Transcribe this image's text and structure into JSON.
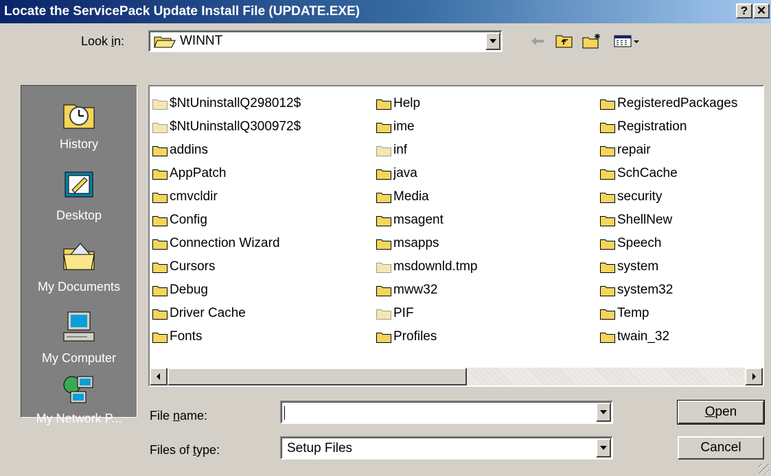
{
  "window": {
    "title": "Locate the ServicePack Update Install File (UPDATE.EXE)",
    "help_button": "?",
    "close_button": "✕"
  },
  "lookin": {
    "label_pre": "Look ",
    "label_u": "i",
    "label_post": "n:",
    "value": "WINNT"
  },
  "toolbar": {
    "icons": [
      "back-arrow-icon",
      "up-one-level-icon",
      "new-folder-icon",
      "view-menu-icon"
    ]
  },
  "places": [
    {
      "label": "History",
      "icon": "history-icon"
    },
    {
      "label": "Desktop",
      "icon": "desktop-icon"
    },
    {
      "label": "My Documents",
      "icon": "my-documents-icon"
    },
    {
      "label": "My Computer",
      "icon": "my-computer-icon"
    },
    {
      "label": "My Network P...",
      "icon": "my-network-places-icon"
    }
  ],
  "files": {
    "col1": [
      "$NtUninstallQ298012$",
      "$NtUninstallQ300972$",
      "addins",
      "AppPatch",
      "cmvcldir",
      "Config",
      "Connection Wizard",
      "Cursors",
      "Debug",
      "Driver Cache",
      "Fonts"
    ],
    "col2": [
      "Help",
      "ime",
      "inf",
      "java",
      "Media",
      "msagent",
      "msapps",
      "msdownld.tmp",
      "mww32",
      "PIF",
      "Profiles"
    ],
    "col3": [
      "RegisteredPackages",
      "Registration",
      "repair",
      "SchCache",
      "security",
      "ShellNew",
      "Speech",
      "system",
      "system32",
      "Temp",
      "twain_32"
    ],
    "hidden_folders": [
      "$NtUninstallQ298012$",
      "$NtUninstallQ300972$",
      "inf",
      "msdownld.tmp",
      "PIF"
    ]
  },
  "filename": {
    "label_pre": "File ",
    "label_u": "n",
    "label_post": "ame:",
    "value": ""
  },
  "filetype": {
    "label_pre": "Files of ",
    "label_u": "t",
    "label_post": "ype:",
    "value": "Setup Files"
  },
  "buttons": {
    "open_u": "O",
    "open_rest": "pen",
    "cancel": "Cancel"
  },
  "colors": {
    "folder": "#f5d55a",
    "hidden_folder": "#f2e7b4",
    "title_start": "#0a246a",
    "title_end": "#a6caf0"
  }
}
